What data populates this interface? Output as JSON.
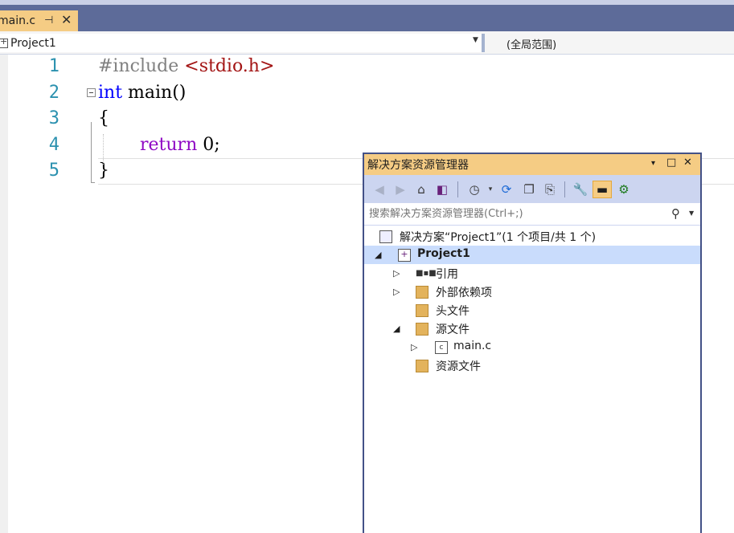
{
  "tab": {
    "title": "main.c",
    "pin_icon": "pin-icon",
    "close_icon": "close-icon"
  },
  "navbar": {
    "project": "Project1",
    "scope": "(全局范围)"
  },
  "editor": {
    "lines": [
      {
        "n": "1",
        "pre": "#include ",
        "inc": "<stdio.h>"
      },
      {
        "n": "2",
        "kw": "int",
        "rest": " main()"
      },
      {
        "n": "3",
        "rest": "{"
      },
      {
        "n": "4",
        "kw": "return",
        "rest": " 0;"
      },
      {
        "n": "5",
        "rest": "}"
      }
    ]
  },
  "solution_explorer": {
    "title": "解决方案资源管理器",
    "title_buttons": [
      "▾",
      "□",
      "✕"
    ],
    "search_placeholder": "搜索解决方案资源管理器(Ctrl+;)",
    "tree": [
      {
        "label": "解决方案“Project1”(1 个项目/共 1 个)",
        "icon": "solution-icon"
      },
      {
        "label": "Project1",
        "icon": "project-icon",
        "expanded": true,
        "selected": true
      },
      {
        "label": "引用",
        "icon": "references-icon"
      },
      {
        "label": "外部依赖项",
        "icon": "external-deps-icon"
      },
      {
        "label": "头文件",
        "icon": "filter-folder-icon"
      },
      {
        "label": "源文件",
        "icon": "filter-folder-icon",
        "expanded": true
      },
      {
        "label": "main.c",
        "icon": "c-file-icon"
      },
      {
        "label": "资源文件",
        "icon": "filter-folder-icon"
      }
    ]
  }
}
